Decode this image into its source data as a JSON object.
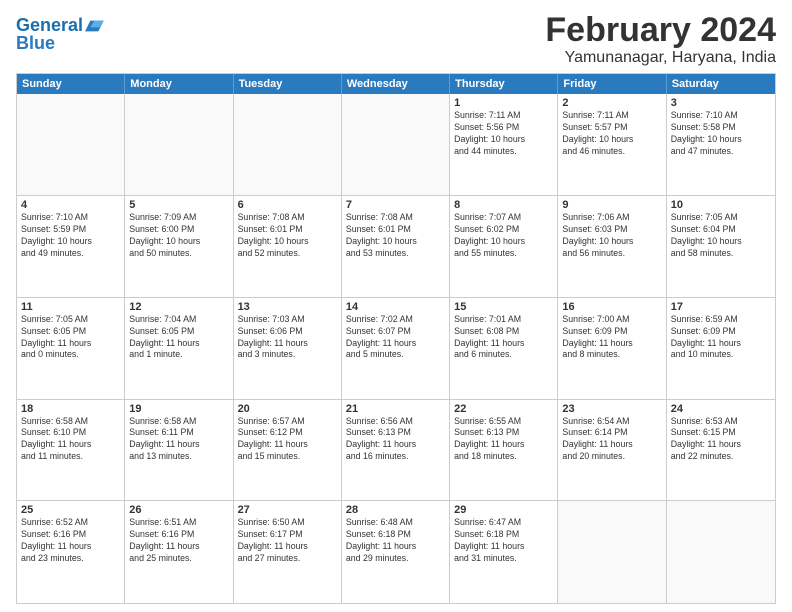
{
  "logo": {
    "line1": "General",
    "line2": "Blue"
  },
  "title": "February 2024",
  "subtitle": "Yamunanagar, Haryana, India",
  "header_days": [
    "Sunday",
    "Monday",
    "Tuesday",
    "Wednesday",
    "Thursday",
    "Friday",
    "Saturday"
  ],
  "weeks": [
    [
      {
        "day": "",
        "info": ""
      },
      {
        "day": "",
        "info": ""
      },
      {
        "day": "",
        "info": ""
      },
      {
        "day": "",
        "info": ""
      },
      {
        "day": "1",
        "info": "Sunrise: 7:11 AM\nSunset: 5:56 PM\nDaylight: 10 hours\nand 44 minutes."
      },
      {
        "day": "2",
        "info": "Sunrise: 7:11 AM\nSunset: 5:57 PM\nDaylight: 10 hours\nand 46 minutes."
      },
      {
        "day": "3",
        "info": "Sunrise: 7:10 AM\nSunset: 5:58 PM\nDaylight: 10 hours\nand 47 minutes."
      }
    ],
    [
      {
        "day": "4",
        "info": "Sunrise: 7:10 AM\nSunset: 5:59 PM\nDaylight: 10 hours\nand 49 minutes."
      },
      {
        "day": "5",
        "info": "Sunrise: 7:09 AM\nSunset: 6:00 PM\nDaylight: 10 hours\nand 50 minutes."
      },
      {
        "day": "6",
        "info": "Sunrise: 7:08 AM\nSunset: 6:01 PM\nDaylight: 10 hours\nand 52 minutes."
      },
      {
        "day": "7",
        "info": "Sunrise: 7:08 AM\nSunset: 6:01 PM\nDaylight: 10 hours\nand 53 minutes."
      },
      {
        "day": "8",
        "info": "Sunrise: 7:07 AM\nSunset: 6:02 PM\nDaylight: 10 hours\nand 55 minutes."
      },
      {
        "day": "9",
        "info": "Sunrise: 7:06 AM\nSunset: 6:03 PM\nDaylight: 10 hours\nand 56 minutes."
      },
      {
        "day": "10",
        "info": "Sunrise: 7:05 AM\nSunset: 6:04 PM\nDaylight: 10 hours\nand 58 minutes."
      }
    ],
    [
      {
        "day": "11",
        "info": "Sunrise: 7:05 AM\nSunset: 6:05 PM\nDaylight: 11 hours\nand 0 minutes."
      },
      {
        "day": "12",
        "info": "Sunrise: 7:04 AM\nSunset: 6:05 PM\nDaylight: 11 hours\nand 1 minute."
      },
      {
        "day": "13",
        "info": "Sunrise: 7:03 AM\nSunset: 6:06 PM\nDaylight: 11 hours\nand 3 minutes."
      },
      {
        "day": "14",
        "info": "Sunrise: 7:02 AM\nSunset: 6:07 PM\nDaylight: 11 hours\nand 5 minutes."
      },
      {
        "day": "15",
        "info": "Sunrise: 7:01 AM\nSunset: 6:08 PM\nDaylight: 11 hours\nand 6 minutes."
      },
      {
        "day": "16",
        "info": "Sunrise: 7:00 AM\nSunset: 6:09 PM\nDaylight: 11 hours\nand 8 minutes."
      },
      {
        "day": "17",
        "info": "Sunrise: 6:59 AM\nSunset: 6:09 PM\nDaylight: 11 hours\nand 10 minutes."
      }
    ],
    [
      {
        "day": "18",
        "info": "Sunrise: 6:58 AM\nSunset: 6:10 PM\nDaylight: 11 hours\nand 11 minutes."
      },
      {
        "day": "19",
        "info": "Sunrise: 6:58 AM\nSunset: 6:11 PM\nDaylight: 11 hours\nand 13 minutes."
      },
      {
        "day": "20",
        "info": "Sunrise: 6:57 AM\nSunset: 6:12 PM\nDaylight: 11 hours\nand 15 minutes."
      },
      {
        "day": "21",
        "info": "Sunrise: 6:56 AM\nSunset: 6:13 PM\nDaylight: 11 hours\nand 16 minutes."
      },
      {
        "day": "22",
        "info": "Sunrise: 6:55 AM\nSunset: 6:13 PM\nDaylight: 11 hours\nand 18 minutes."
      },
      {
        "day": "23",
        "info": "Sunrise: 6:54 AM\nSunset: 6:14 PM\nDaylight: 11 hours\nand 20 minutes."
      },
      {
        "day": "24",
        "info": "Sunrise: 6:53 AM\nSunset: 6:15 PM\nDaylight: 11 hours\nand 22 minutes."
      }
    ],
    [
      {
        "day": "25",
        "info": "Sunrise: 6:52 AM\nSunset: 6:16 PM\nDaylight: 11 hours\nand 23 minutes."
      },
      {
        "day": "26",
        "info": "Sunrise: 6:51 AM\nSunset: 6:16 PM\nDaylight: 11 hours\nand 25 minutes."
      },
      {
        "day": "27",
        "info": "Sunrise: 6:50 AM\nSunset: 6:17 PM\nDaylight: 11 hours\nand 27 minutes."
      },
      {
        "day": "28",
        "info": "Sunrise: 6:48 AM\nSunset: 6:18 PM\nDaylight: 11 hours\nand 29 minutes."
      },
      {
        "day": "29",
        "info": "Sunrise: 6:47 AM\nSunset: 6:18 PM\nDaylight: 11 hours\nand 31 minutes."
      },
      {
        "day": "",
        "info": ""
      },
      {
        "day": "",
        "info": ""
      }
    ]
  ]
}
